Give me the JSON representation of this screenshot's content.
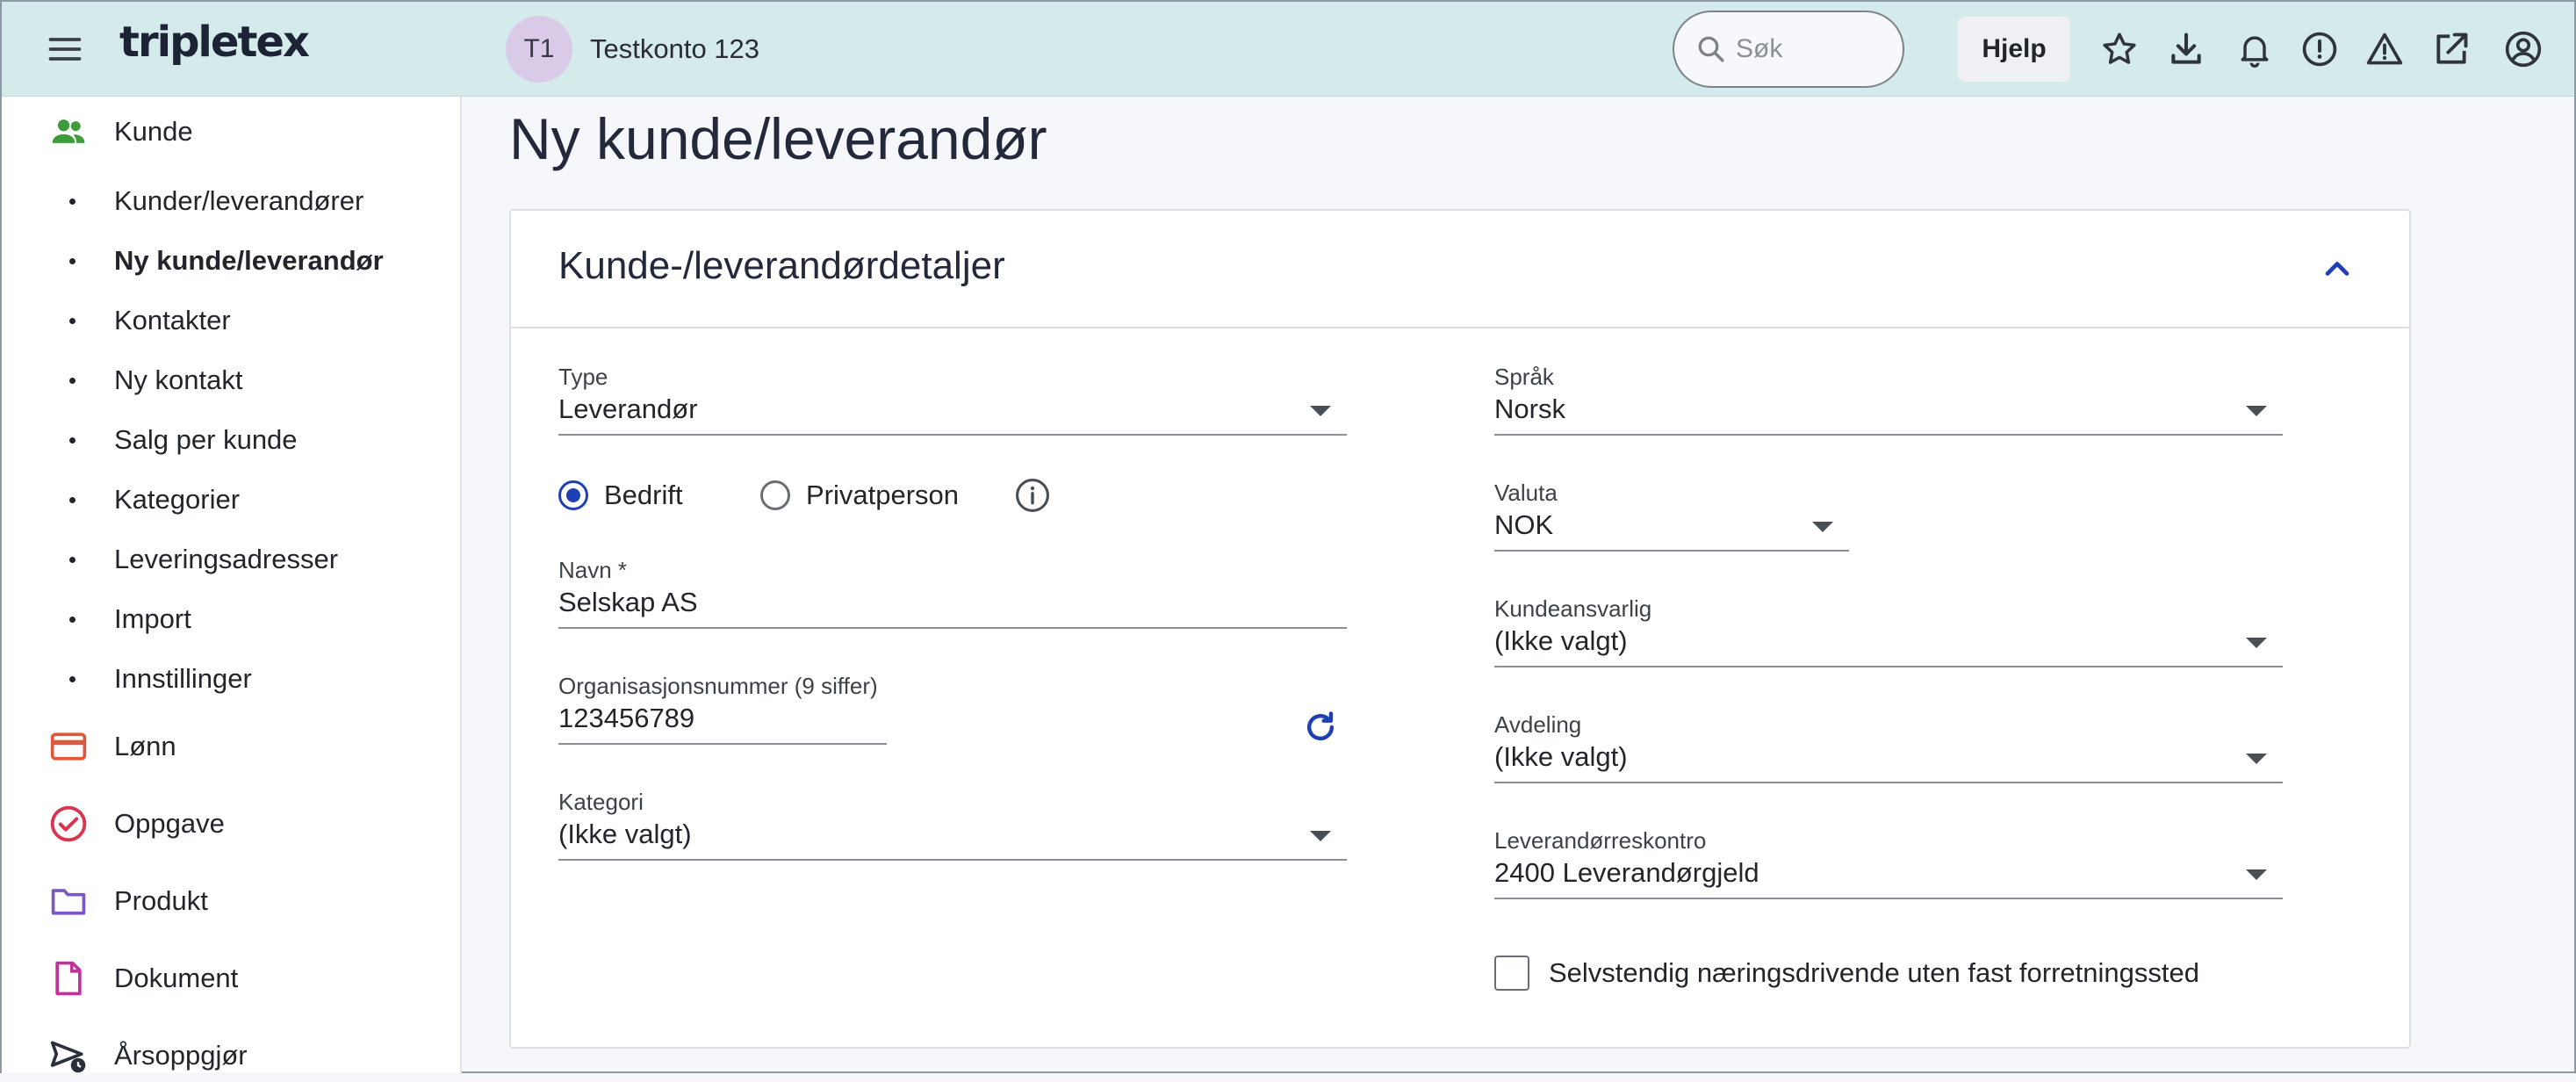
{
  "app": {
    "logo": "tripletex"
  },
  "topbar": {
    "account_initials": "T1",
    "account_name": "Testkonto 123",
    "search_placeholder": "Søk",
    "help_label": "Hjelp",
    "icons": [
      "star-icon",
      "download-icon",
      "bell-icon",
      "alert-circle-icon",
      "warning-triangle-icon",
      "external-link-icon",
      "user-circle-icon"
    ]
  },
  "sidebar": {
    "kunde": "Kunde",
    "sub_items": [
      "Kunder/leverandører",
      "Ny kunde/leverandør",
      "Kontakter",
      "Ny kontakt",
      "Salg per kunde",
      "Kategorier",
      "Leveringsadresser",
      "Import",
      "Innstillinger"
    ],
    "active_sub_item": "Ny kunde/leverandør",
    "lonn": "Lønn",
    "oppgave": "Oppgave",
    "produkt": "Produkt",
    "dokument": "Dokument",
    "arsoppgjor": "Årsoppgjør",
    "colors": {
      "kunde": "#3e9b3a",
      "lonn": "#e0583b",
      "oppgave": "#d8354f",
      "produkt": "#7a58c4",
      "dokument": "#c0339a",
      "arsoppgjor": "#2a2f3a"
    }
  },
  "main": {
    "page_title": "Ny kunde/leverandør",
    "card_title": "Kunde-/leverandørdetaljer",
    "left": {
      "type_label": "Type",
      "type_value": "Leverandør",
      "radio_company": "Bedrift",
      "radio_private": "Privatperson",
      "radio_selected": "Bedrift",
      "name_label": "Navn *",
      "name_value": "Selskap AS",
      "orgnr_label": "Organisasjonsnummer (9 siffer)",
      "orgnr_value": "123456789",
      "category_label": "Kategori",
      "category_value": "(Ikke valgt)"
    },
    "right": {
      "language_label": "Språk",
      "language_value": "Norsk",
      "currency_label": "Valuta",
      "currency_value": "NOK",
      "responsible_label": "Kundeansvarlig",
      "responsible_value": "(Ikke valgt)",
      "department_label": "Avdeling",
      "department_value": "(Ikke valgt)",
      "ledger_label": "Leverandørreskontro",
      "ledger_value": "2400 Leverandørgjeld",
      "selfemployed_label": "Selvstendig næringsdrivende uten fast forretningssted",
      "selfemployed_checked": false
    },
    "accent_color": "#1f3fb4"
  }
}
